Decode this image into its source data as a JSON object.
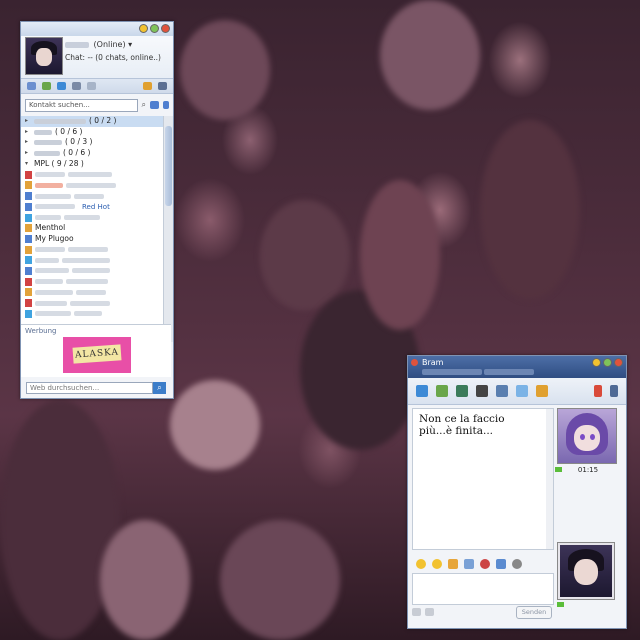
{
  "contacts_window": {
    "status": "(Online)",
    "chats": "Chat: -- (0 chats, online..)",
    "search_placeholder": "Kontakt suchen...",
    "groups": [
      {
        "count": "( 0 / 2 )"
      },
      {
        "count": "( 0 / 6 )"
      },
      {
        "count": "( 0 / 3 )"
      },
      {
        "count": "( 0 / 6 )"
      }
    ],
    "mpl_group": "MPL ( 9 / 28 )",
    "contacts_visible": [
      "Menthol",
      "My Plugoo"
    ],
    "redhot_label": "Red Hot",
    "ad_label": "Werbung",
    "ad_text": "ALASKA",
    "websearch_placeholder": "Web durchsuchen..."
  },
  "chat_window": {
    "title": "Bram",
    "message": "Non ce la faccio\npiù...è finita...",
    "time": "01:15",
    "send_label": "Senden"
  },
  "colors": {
    "titlebar_blue": "#2f4d82",
    "selection": "#c9dcf2",
    "online_green": "#5bbd3a"
  }
}
